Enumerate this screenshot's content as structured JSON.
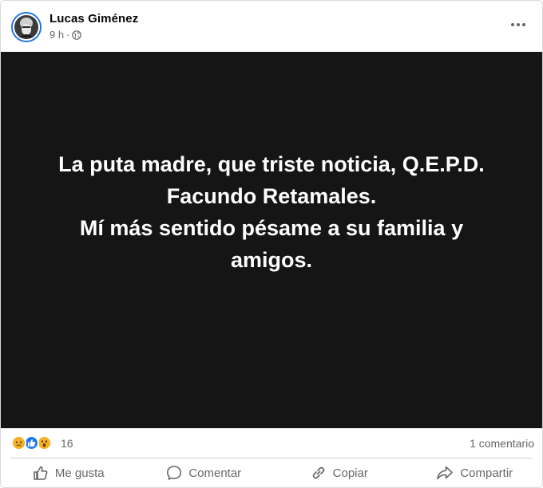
{
  "post": {
    "author_name": "Lucas Giménez",
    "time": "9 h",
    "separator": "·",
    "privacy_icon": "globe-icon",
    "more_icon": "more-options-icon",
    "image_text_lines": [
      "La puta madre, que triste noticia, Q.E.P.D.",
      "Facundo Retamales.",
      "Mí más sentido pésame a su familia y",
      "amigos."
    ],
    "image_background": "#151516",
    "reactions": {
      "icons": [
        "sad-reaction-icon",
        "like-reaction-icon",
        "wow-reaction-icon"
      ],
      "count": "16",
      "comments": "1 comentario"
    },
    "actions": [
      {
        "label": "Me gusta",
        "icon": "thumbs-up-icon"
      },
      {
        "label": "Comentar",
        "icon": "comment-icon"
      },
      {
        "label": "Copiar",
        "icon": "link-icon"
      },
      {
        "label": "Compartir",
        "icon": "share-icon"
      }
    ],
    "colors": {
      "accent": "#1b74e4",
      "secondary_text": "#65676b",
      "like_blue": "#1877f2",
      "reaction_yellow": "#f7b125"
    }
  }
}
